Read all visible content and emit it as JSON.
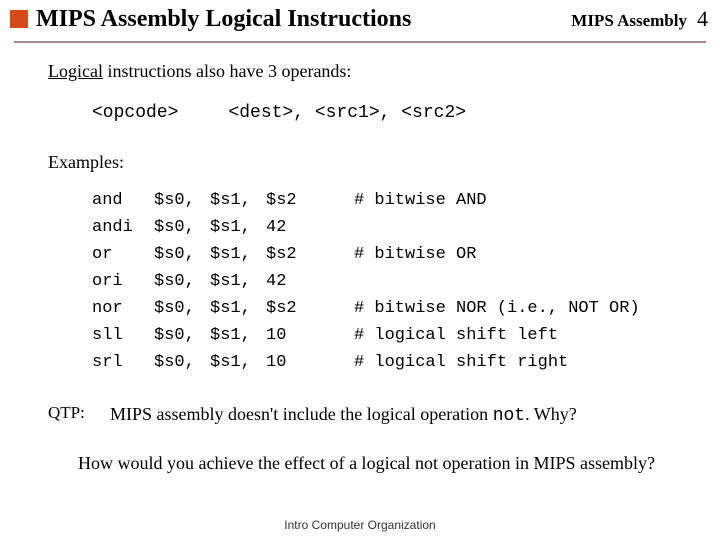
{
  "header": {
    "title": "MIPS Assembly Logical Instructions",
    "course": "MIPS Assembly",
    "page": "4"
  },
  "intro": {
    "underlined": "Logical",
    "rest": " instructions also have 3 operands:"
  },
  "syntax": {
    "opcode": "<opcode>",
    "operands": "<dest>, <src1>, <src2>"
  },
  "examples_label": "Examples:",
  "examples": [
    {
      "op": "and",
      "dest": "$s0,",
      "src1": "$s1,",
      "src2": "$s2",
      "comment": "# bitwise AND"
    },
    {
      "op": "andi",
      "dest": "$s0,",
      "src1": "$s1,",
      "src2": "42",
      "comment": ""
    },
    {
      "op": "or",
      "dest": "$s0,",
      "src1": "$s1,",
      "src2": "$s2",
      "comment": "# bitwise OR"
    },
    {
      "op": "ori",
      "dest": "$s0,",
      "src1": "$s1,",
      "src2": "42",
      "comment": ""
    },
    {
      "op": "nor",
      "dest": "$s0,",
      "src1": "$s1,",
      "src2": "$s2",
      "comment": "# bitwise NOR (i.e., NOT OR)"
    },
    {
      "op": "sll",
      "dest": "$s0,",
      "src1": "$s1,",
      "src2": "10",
      "comment": "# logical shift left"
    },
    {
      "op": "srl",
      "dest": "$s0,",
      "src1": "$s1,",
      "src2": "10",
      "comment": "# logical shift right"
    }
  ],
  "qtp": {
    "label": "QTP:",
    "before_mono": "MIPS assembly doesn't include the logical operation ",
    "mono": "not",
    "after_mono": ".  Why?"
  },
  "followup": "How would you achieve the effect of a logical not operation in MIPS assembly?",
  "footer": "Intro Computer Organization"
}
